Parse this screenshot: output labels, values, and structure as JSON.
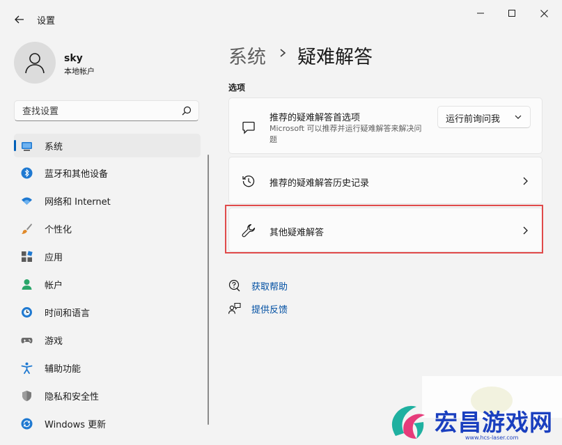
{
  "window": {
    "title": "设置",
    "controls": [
      "minimize-icon",
      "maximize-icon",
      "close-icon"
    ]
  },
  "profile": {
    "name": "sky",
    "account_type": "本地帐户"
  },
  "search": {
    "placeholder": "查找设置",
    "value": ""
  },
  "nav": {
    "items": [
      {
        "label": "系统",
        "icon": "system-icon",
        "active": true
      },
      {
        "label": "蓝牙和其他设备",
        "icon": "bluetooth-icon"
      },
      {
        "label": "网络和 Internet",
        "icon": "wifi-icon"
      },
      {
        "label": "个性化",
        "icon": "brush-icon"
      },
      {
        "label": "应用",
        "icon": "apps-icon"
      },
      {
        "label": "帐户",
        "icon": "person-icon"
      },
      {
        "label": "时间和语言",
        "icon": "globe-clock-icon"
      },
      {
        "label": "游戏",
        "icon": "gamepad-icon"
      },
      {
        "label": "辅助功能",
        "icon": "accessibility-icon"
      },
      {
        "label": "隐私和安全性",
        "icon": "shield-icon"
      },
      {
        "label": "Windows 更新",
        "icon": "update-icon"
      }
    ]
  },
  "breadcrumb": {
    "parent": "系统",
    "current": "疑难解答"
  },
  "section_label": "选项",
  "cards": {
    "preferences": {
      "title": "推荐的疑难解答首选项",
      "description": "Microsoft 可以推荐并运行疑难解答来解决问题",
      "dropdown_value": "运行前询问我",
      "icon": "chat-icon"
    },
    "history": {
      "title": "推荐的疑难解答历史记录",
      "icon": "history-icon"
    },
    "other": {
      "title": "其他疑难解答",
      "icon": "wrench-icon"
    }
  },
  "links": {
    "help": "获取帮助",
    "feedback": "提供反馈"
  },
  "watermark": {
    "text": "宏昌游戏网",
    "url": "www.hcs-laser.com"
  },
  "colors": {
    "accent": "#005fb8",
    "link": "#004fa3",
    "highlight": "#e04a4a",
    "watermark": "#1a3fbf"
  }
}
